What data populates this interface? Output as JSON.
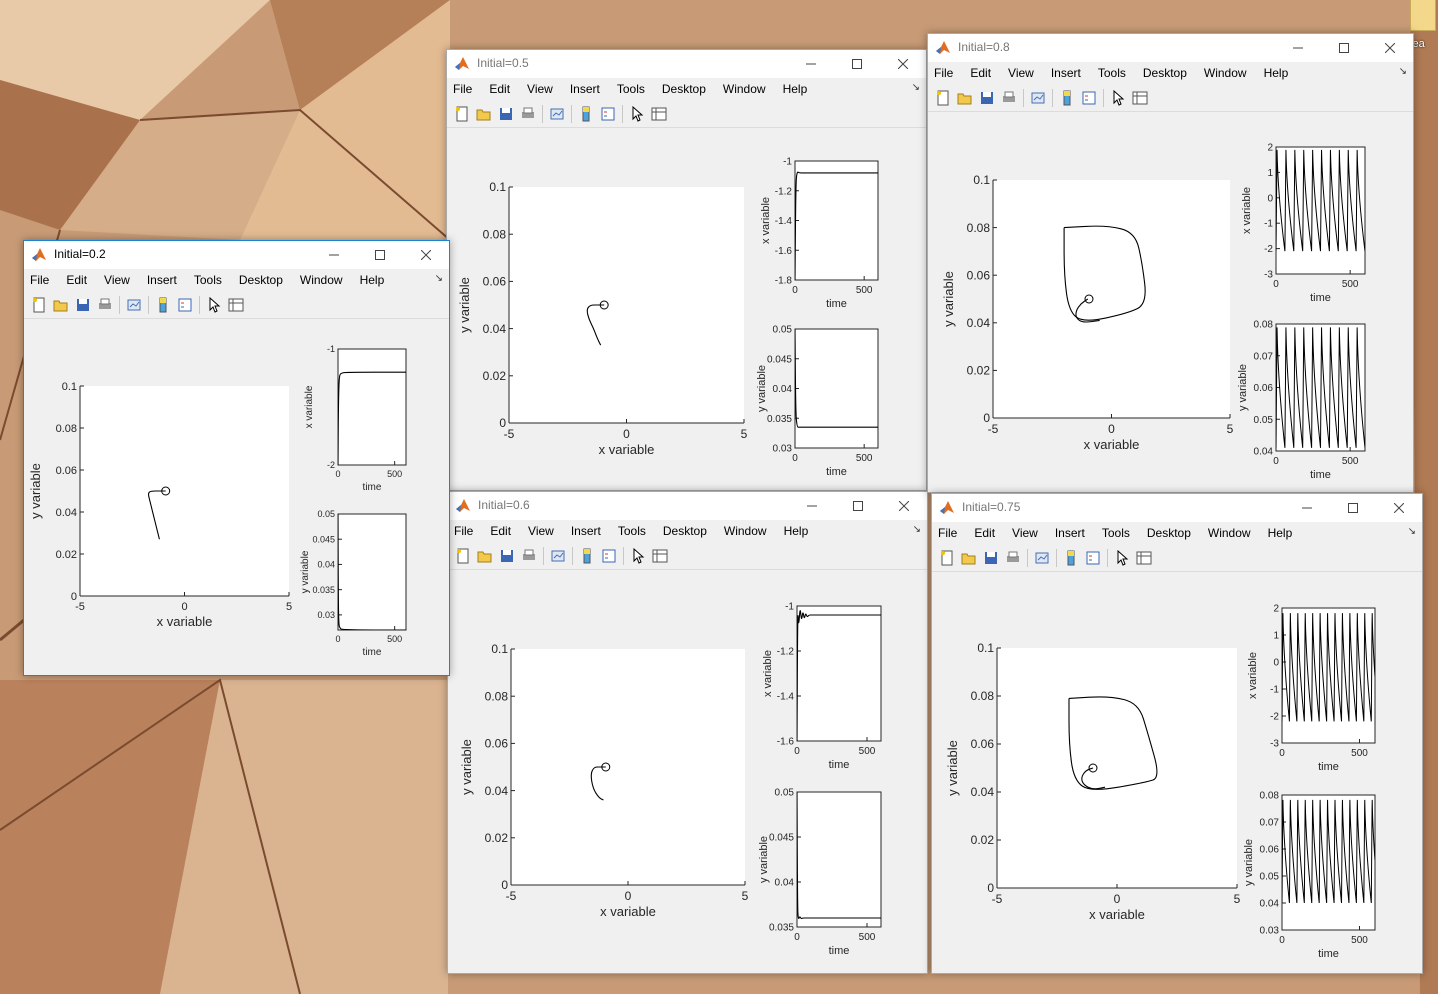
{
  "desktop": {
    "icon_label": "idea"
  },
  "menu": [
    "File",
    "Edit",
    "View",
    "Insert",
    "Tools",
    "Desktop",
    "Window",
    "Help"
  ],
  "windows": [
    {
      "id": "w02",
      "title": "Initial=0.2",
      "active": true,
      "chart_data": [
        {
          "type": "line",
          "role": "phase-portrait",
          "xlabel": "x variable",
          "ylabel": "y variable",
          "xlim": [
            -5,
            5
          ],
          "ylim": [
            0,
            0.1
          ],
          "xticks": [
            "-5",
            "0",
            "5"
          ],
          "yticks": [
            "0",
            "0.02",
            "0.04",
            "0.06",
            "0.08",
            "0.1"
          ],
          "series": [
            {
              "x": [
                -1.2,
                -1.35,
                -1.5,
                -1.65,
                -1.75,
                -1.6,
                -1.2,
                -0.9
              ],
              "y": [
                0.027,
                0.033,
                0.039,
                0.045,
                0.049,
                0.05,
                0.05,
                0.05
              ]
            }
          ],
          "marker": {
            "x": -0.9,
            "y": 0.05
          }
        },
        {
          "type": "line",
          "role": "x-vs-time",
          "xlabel": "time",
          "ylabel": "x variable",
          "xlim": [
            0,
            600
          ],
          "ylim": [
            -2,
            -1
          ],
          "xticks": [
            "0",
            "500"
          ],
          "yticks": [
            "-2",
            "-1"
          ],
          "series": [
            {
              "x": [
                0,
                3,
                8,
                15,
                30,
                60,
                600
              ],
              "y": [
                -2.0,
                -1.55,
                -1.3,
                -1.22,
                -1.21,
                -1.2,
                -1.2
              ]
            }
          ]
        },
        {
          "type": "line",
          "role": "y-vs-time",
          "xlabel": "time",
          "ylabel": "y variable",
          "xlim": [
            0,
            600
          ],
          "ylim": [
            0.027,
            0.05
          ],
          "xticks": [
            "0",
            "500"
          ],
          "yticks": [
            "0.03",
            "0.035",
            "0.04",
            "0.045",
            "0.05"
          ],
          "series": [
            {
              "x": [
                0,
                3,
                8,
                15,
                30,
                600
              ],
              "y": [
                0.05,
                0.032,
                0.028,
                0.0275,
                0.027,
                0.027
              ]
            }
          ]
        }
      ]
    },
    {
      "id": "w05",
      "title": "Initial=0.5",
      "active": false,
      "chart_data": [
        {
          "type": "line",
          "role": "phase-portrait",
          "xlabel": "x variable",
          "ylabel": "y variable",
          "xlim": [
            -5,
            5
          ],
          "ylim": [
            0,
            0.1
          ],
          "xticks": [
            "-5",
            "0",
            "5"
          ],
          "yticks": [
            "0",
            "0.02",
            "0.04",
            "0.06",
            "0.08",
            "0.1"
          ],
          "series": [
            {
              "x": [
                -1.1,
                -1.25,
                -1.4,
                -1.6,
                -1.7,
                -1.55,
                -1.2,
                -0.95
              ],
              "y": [
                0.033,
                0.036,
                0.04,
                0.044,
                0.048,
                0.05,
                0.05,
                0.05
              ]
            }
          ],
          "marker": {
            "x": -0.95,
            "y": 0.05
          }
        },
        {
          "type": "line",
          "role": "x-vs-time",
          "xlabel": "time",
          "ylabel": "x variable",
          "xlim": [
            0,
            600
          ],
          "ylim": [
            -1.8,
            -1
          ],
          "xticks": [
            "0",
            "500"
          ],
          "yticks": [
            "-1.8",
            "-1.6",
            "-1.4",
            "-1.2",
            "-1"
          ],
          "series": [
            {
              "x": [
                0,
                6,
                15,
                30,
                60,
                600
              ],
              "y": [
                -1.8,
                -1.15,
                -1.07,
                -1.08,
                -1.08,
                -1.08
              ]
            }
          ]
        },
        {
          "type": "line",
          "role": "y-vs-time",
          "xlabel": "time",
          "ylabel": "y variable",
          "xlim": [
            0,
            600
          ],
          "ylim": [
            0.03,
            0.05
          ],
          "xticks": [
            "0",
            "500"
          ],
          "yticks": [
            "0.03",
            "0.035",
            "0.04",
            "0.045",
            "0.05"
          ],
          "series": [
            {
              "x": [
                0,
                5,
                15,
                30,
                60,
                600
              ],
              "y": [
                0.05,
                0.036,
                0.0335,
                0.0335,
                0.0335,
                0.0335
              ]
            }
          ]
        }
      ]
    },
    {
      "id": "w08",
      "title": "Initial=0.8",
      "active": false,
      "chart_data": [
        {
          "type": "line",
          "role": "phase-portrait",
          "xlabel": "x variable",
          "ylabel": "y variable",
          "xlim": [
            -5,
            5
          ],
          "ylim": [
            0,
            0.1
          ],
          "xticks": [
            "-5",
            "0",
            "5"
          ],
          "yticks": [
            "0",
            "0.02",
            "0.04",
            "0.06",
            "0.08",
            "0.1"
          ],
          "series": [
            {
              "x": [
                -1.0,
                -1.3,
                -1.5,
                -1.5,
                -1.2,
                -0.5
              ],
              "y": [
                0.05,
                0.048,
                0.045,
                0.042,
                0.04,
                0.041
              ],
              "closed": false
            },
            {
              "x": [
                -2.0,
                -0.2,
                1.0,
                1.3,
                1.5,
                0.7,
                -1.2,
                -1.8,
                -2.0,
                -2.0
              ],
              "y": [
                0.08,
                0.081,
                0.078,
                0.065,
                0.048,
                0.044,
                0.04,
                0.045,
                0.06,
                0.08
              ],
              "closed": true
            }
          ],
          "marker": {
            "x": -0.95,
            "y": 0.05
          }
        },
        {
          "type": "line",
          "role": "x-vs-time",
          "xlabel": "time",
          "ylabel": "x variable",
          "xlim": [
            0,
            600
          ],
          "ylim": [
            -3,
            2
          ],
          "xticks": [
            "0",
            "500"
          ],
          "yticks": [
            "-3",
            "-2",
            "-1",
            "0",
            "1",
            "2"
          ],
          "oscillation": {
            "period": 60,
            "low": -2.1,
            "high": 2.0
          }
        },
        {
          "type": "line",
          "role": "y-vs-time",
          "xlabel": "time",
          "ylabel": "y variable",
          "xlim": [
            0,
            600
          ],
          "ylim": [
            0.04,
            0.08
          ],
          "xticks": [
            "0",
            "500"
          ],
          "yticks": [
            "0.04",
            "0.05",
            "0.06",
            "0.07",
            "0.08"
          ],
          "oscillation": {
            "period": 60,
            "low": 0.041,
            "high": 0.08
          }
        }
      ]
    },
    {
      "id": "w06",
      "title": "Initial=0.6",
      "active": false,
      "chart_data": [
        {
          "type": "line",
          "role": "phase-portrait",
          "xlabel": "x variable",
          "ylabel": "y variable",
          "xlim": [
            -5,
            5
          ],
          "ylim": [
            0,
            0.1
          ],
          "xticks": [
            "-5",
            "0",
            "5"
          ],
          "yticks": [
            "0",
            "0.02",
            "0.04",
            "0.06",
            "0.08",
            "0.1"
          ],
          "series": [
            {
              "x": [
                -1.05,
                -1.25,
                -1.5,
                -1.6,
                -1.45,
                -1.2,
                -0.95
              ],
              "y": [
                0.036,
                0.037,
                0.041,
                0.047,
                0.05,
                0.05,
                0.05
              ]
            }
          ],
          "marker": {
            "x": -0.95,
            "y": 0.05
          }
        },
        {
          "type": "line",
          "role": "x-vs-time",
          "xlabel": "time",
          "ylabel": "x variable",
          "xlim": [
            0,
            600
          ],
          "ylim": [
            -1.6,
            -1
          ],
          "xticks": [
            "0",
            "500"
          ],
          "yticks": [
            "-1.6",
            "-1.4",
            "-1.2",
            "-1"
          ],
          "series": [
            {
              "x": [
                0,
                5,
                12,
                22,
                32,
                42,
                52,
                62,
                72,
                85,
                100,
                600
              ],
              "y": [
                -1.6,
                -1.0,
                -1.1,
                -1.0,
                -1.07,
                -1.02,
                -1.06,
                -1.03,
                -1.05,
                -1.04,
                -1.04,
                -1.04
              ]
            }
          ]
        },
        {
          "type": "line",
          "role": "y-vs-time",
          "xlabel": "time",
          "ylabel": "y variable",
          "xlim": [
            0,
            600
          ],
          "ylim": [
            0.035,
            0.05
          ],
          "xticks": [
            "0",
            "500"
          ],
          "yticks": [
            "0.035",
            "0.04",
            "0.045",
            "0.05"
          ],
          "series": [
            {
              "x": [
                0,
                4,
                10,
                20,
                30,
                40,
                60,
                600
              ],
              "y": [
                0.05,
                0.037,
                0.0358,
                0.0362,
                0.0359,
                0.036,
                0.036,
                0.036
              ]
            }
          ]
        }
      ]
    },
    {
      "id": "w075",
      "title": "Initial=0.75",
      "active": false,
      "chart_data": [
        {
          "type": "line",
          "role": "phase-portrait",
          "xlabel": "x variable",
          "ylabel": "y variable",
          "xlim": [
            -5,
            5
          ],
          "ylim": [
            0,
            0.1
          ],
          "xticks": [
            "-5",
            "0",
            "5"
          ],
          "yticks": [
            "0",
            "0.02",
            "0.04",
            "0.06",
            "0.08",
            "0.1"
          ],
          "series": [
            {
              "x": [
                -1.0,
                -1.3,
                -1.5,
                -1.4,
                -1.0,
                -0.5
              ],
              "y": [
                0.05,
                0.049,
                0.046,
                0.043,
                0.041,
                0.042
              ],
              "closed": false
            },
            {
              "x": [
                -2.0,
                -0.3,
                0.9,
                1.3,
                1.8,
                1.2,
                -1.1,
                -1.8,
                -2.0,
                -2.0
              ],
              "y": [
                0.079,
                0.08,
                0.077,
                0.064,
                0.046,
                0.044,
                0.04,
                0.045,
                0.06,
                0.079
              ],
              "closed": true
            }
          ],
          "marker": {
            "x": -1.0,
            "y": 0.05
          }
        },
        {
          "type": "line",
          "role": "x-vs-time",
          "xlabel": "time",
          "ylabel": "x variable",
          "xlim": [
            0,
            600
          ],
          "ylim": [
            -3,
            2
          ],
          "xticks": [
            "0",
            "500"
          ],
          "yticks": [
            "-3",
            "-2",
            "-1",
            "0",
            "1",
            "2"
          ],
          "oscillation": {
            "period": 48,
            "low": -2.2,
            "high": 2.0
          }
        },
        {
          "type": "line",
          "role": "y-vs-time",
          "xlabel": "time",
          "ylabel": "y variable",
          "xlim": [
            0,
            600
          ],
          "ylim": [
            0.03,
            0.08
          ],
          "xticks": [
            "0",
            "500"
          ],
          "yticks": [
            "0.03",
            "0.04",
            "0.05",
            "0.06",
            "0.07",
            "0.08"
          ],
          "oscillation": {
            "period": 48,
            "low": 0.04,
            "high": 0.08
          }
        }
      ]
    }
  ]
}
